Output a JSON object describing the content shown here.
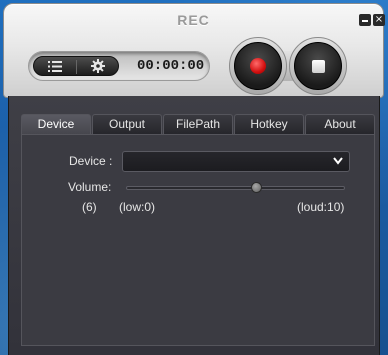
{
  "app": {
    "title": "REC"
  },
  "window_controls": {
    "close_glyph": "×"
  },
  "toolbar": {
    "timer": "00:00:00",
    "list_icon": "list-icon",
    "settings_icon": "gear-icon"
  },
  "recorder": {
    "record_icon": "record-icon",
    "stop_icon": "stop-icon",
    "record_color": "#d20f0f"
  },
  "tabs": [
    {
      "label": "Device",
      "active": true
    },
    {
      "label": "Output",
      "active": false
    },
    {
      "label": "FilePath",
      "active": false
    },
    {
      "label": "Hotkey",
      "active": false
    },
    {
      "label": "About",
      "active": false
    }
  ],
  "device": {
    "device_label": "Device :",
    "device_value": "",
    "volume_label": "Volume:",
    "volume_value": "(6)",
    "volume_min_label": "(low:0)",
    "volume_max_label": "(loud:10)",
    "volume_level": 6,
    "volume_min": 0,
    "volume_max": 10
  }
}
